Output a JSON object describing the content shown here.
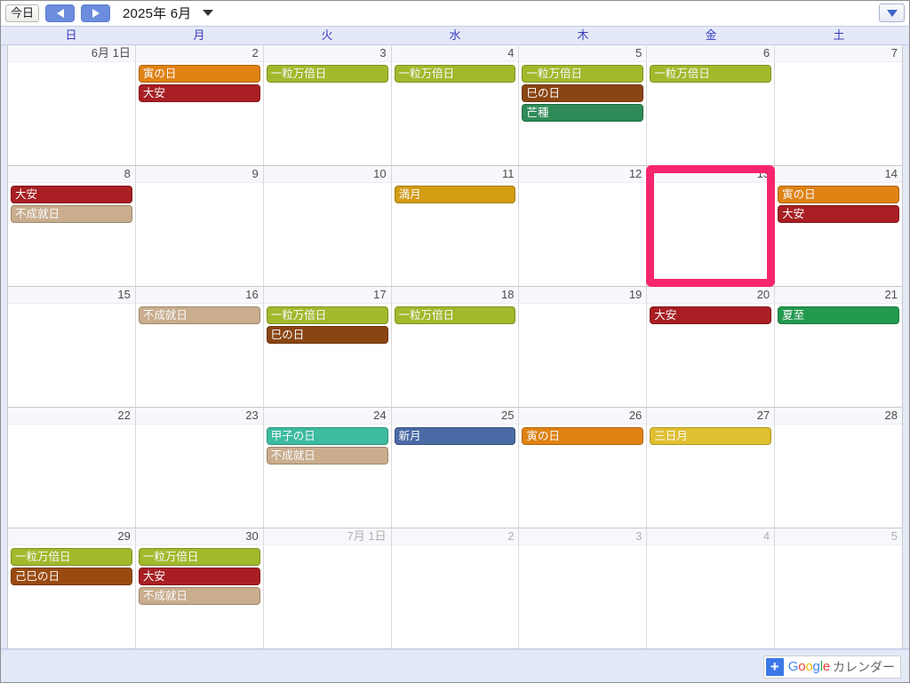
{
  "toolbar": {
    "today_label": "今日",
    "prev_label": "◀",
    "next_label": "▶",
    "month_title": "2025年 6月",
    "dropdown_caret": "▼",
    "view_select_caret": "▼"
  },
  "weekdays": [
    "日",
    "月",
    "火",
    "水",
    "木",
    "金",
    "土"
  ],
  "colors": {
    "ichiryu": "#a3b92c",
    "taian": "#a81e23",
    "tora": "#e08214",
    "mi": "#8a4512",
    "fujoju": "#c9ad8d",
    "bousyu": "#2e8b57",
    "geshi": "#229a4e",
    "mangetsu": "#d39c12",
    "shingetsu": "#4a6aa5",
    "mikazuki": "#e0c030",
    "kinoene": "#3dbca0",
    "tsuchinoto_mi": "#9a4a0e",
    "highlight": "#f6256e",
    "weekday_text": "#3b3bbf",
    "header_bg": "#e4e9f8"
  },
  "weeks": [
    {
      "days": [
        {
          "label": "6月 1日",
          "other": false,
          "events": []
        },
        {
          "label": "2",
          "other": false,
          "events": [
            {
              "title": "寅の日",
              "color": "#e08214"
            },
            {
              "title": "大安",
              "color": "#a81e23"
            }
          ]
        },
        {
          "label": "3",
          "other": false,
          "events": [
            {
              "title": "一粒万倍日",
              "color": "#a3b92c"
            }
          ]
        },
        {
          "label": "4",
          "other": false,
          "events": [
            {
              "title": "一粒万倍日",
              "color": "#a3b92c"
            }
          ]
        },
        {
          "label": "5",
          "other": false,
          "events": [
            {
              "title": "一粒万倍日",
              "color": "#a3b92c"
            },
            {
              "title": "巳の日",
              "color": "#8a4512"
            },
            {
              "title": "芒種",
              "color": "#2e8b57"
            }
          ]
        },
        {
          "label": "6",
          "other": false,
          "events": [
            {
              "title": "一粒万倍日",
              "color": "#a3b92c"
            }
          ]
        },
        {
          "label": "7",
          "other": false,
          "events": []
        }
      ]
    },
    {
      "days": [
        {
          "label": "8",
          "other": false,
          "events": [
            {
              "title": "大安",
              "color": "#a81e23"
            },
            {
              "title": "不成就日",
              "color": "#c9ad8d"
            }
          ]
        },
        {
          "label": "9",
          "other": false,
          "events": []
        },
        {
          "label": "10",
          "other": false,
          "events": []
        },
        {
          "label": "11",
          "other": false,
          "events": [
            {
              "title": "満月",
              "color": "#d39c12"
            }
          ]
        },
        {
          "label": "12",
          "other": false,
          "events": []
        },
        {
          "label": "13",
          "other": false,
          "highlighted": true,
          "events": []
        },
        {
          "label": "14",
          "other": false,
          "events": [
            {
              "title": "寅の日",
              "color": "#e08214"
            },
            {
              "title": "大安",
              "color": "#a81e23"
            }
          ]
        }
      ]
    },
    {
      "days": [
        {
          "label": "15",
          "other": false,
          "events": []
        },
        {
          "label": "16",
          "other": false,
          "events": [
            {
              "title": "不成就日",
              "color": "#c9ad8d"
            }
          ]
        },
        {
          "label": "17",
          "other": false,
          "events": [
            {
              "title": "一粒万倍日",
              "color": "#a3b92c"
            },
            {
              "title": "巳の日",
              "color": "#8a4512"
            }
          ]
        },
        {
          "label": "18",
          "other": false,
          "events": [
            {
              "title": "一粒万倍日",
              "color": "#a3b92c"
            }
          ]
        },
        {
          "label": "19",
          "other": false,
          "events": []
        },
        {
          "label": "20",
          "other": false,
          "events": [
            {
              "title": "大安",
              "color": "#a81e23"
            }
          ]
        },
        {
          "label": "21",
          "other": false,
          "events": [
            {
              "title": "夏至",
              "color": "#229a4e"
            }
          ]
        }
      ]
    },
    {
      "days": [
        {
          "label": "22",
          "other": false,
          "events": []
        },
        {
          "label": "23",
          "other": false,
          "events": []
        },
        {
          "label": "24",
          "other": false,
          "events": [
            {
              "title": "甲子の日",
              "color": "#3dbca0"
            },
            {
              "title": "不成就日",
              "color": "#c9ad8d"
            }
          ]
        },
        {
          "label": "25",
          "other": false,
          "events": [
            {
              "title": "新月",
              "color": "#4a6aa5"
            }
          ]
        },
        {
          "label": "26",
          "other": false,
          "events": [
            {
              "title": "寅の日",
              "color": "#e08214"
            }
          ]
        },
        {
          "label": "27",
          "other": false,
          "events": [
            {
              "title": "三日月",
              "color": "#e0c030"
            }
          ]
        },
        {
          "label": "28",
          "other": false,
          "events": []
        }
      ]
    },
    {
      "days": [
        {
          "label": "29",
          "other": false,
          "events": [
            {
              "title": "一粒万倍日",
              "color": "#a3b92c"
            },
            {
              "title": "己巳の日",
              "color": "#9a4a0e"
            }
          ]
        },
        {
          "label": "30",
          "other": false,
          "events": [
            {
              "title": "一粒万倍日",
              "color": "#a3b92c"
            },
            {
              "title": "大安",
              "color": "#a81e23"
            },
            {
              "title": "不成就日",
              "color": "#c9ad8d"
            }
          ]
        },
        {
          "label": "7月 1日",
          "other": true,
          "events": []
        },
        {
          "label": "2",
          "other": true,
          "events": []
        },
        {
          "label": "3",
          "other": true,
          "events": []
        },
        {
          "label": "4",
          "other": true,
          "events": []
        },
        {
          "label": "5",
          "other": true,
          "events": []
        }
      ]
    }
  ],
  "footer": {
    "plus_label": "+",
    "google_letters": [
      "G",
      "o",
      "o",
      "g",
      "l",
      "e"
    ],
    "calendar_label": "カレンダー"
  }
}
